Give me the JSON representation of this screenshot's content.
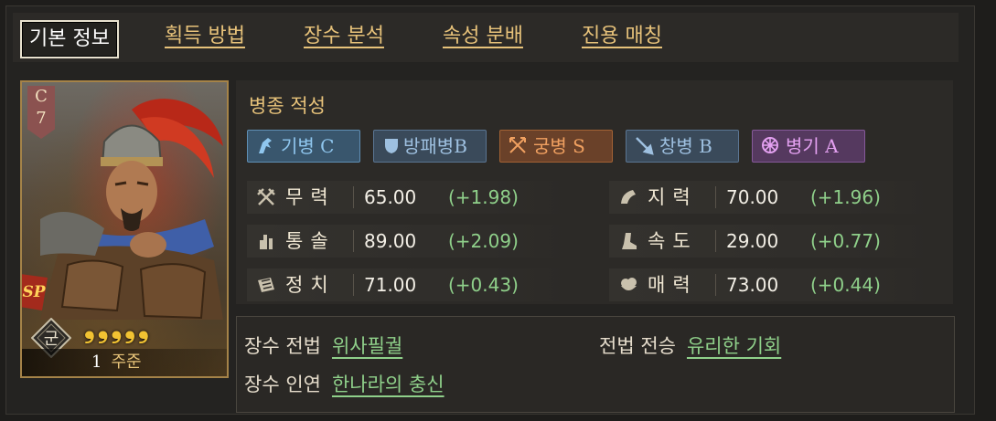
{
  "tabs": [
    "기본 정보",
    "획득 방법",
    "장수 분석",
    "속성 분배",
    "진용 매칭"
  ],
  "card": {
    "grade_letter": "C",
    "grade_number": "7",
    "sp_badge": "SP",
    "stars": "❟❟❟❟❟",
    "faction": "군",
    "level": "1",
    "name": "주준"
  },
  "troop_section": {
    "title": "병종 적성",
    "items": [
      {
        "label": "기병  C",
        "color": "#8fc6ee",
        "bg": "#39566d",
        "border": "#5f8fb5",
        "icon": "cavalry-icon"
      },
      {
        "label": "방패병B",
        "color": "#9ec0e0",
        "bg": "#3a4a5a",
        "border": "#5a7592",
        "icon": "shield-icon"
      },
      {
        "label": "궁병  S",
        "color": "#f0a060",
        "bg": "#6a4129",
        "border": "#a36234",
        "icon": "bow-icon"
      },
      {
        "label": "창병  B",
        "color": "#9ec0e0",
        "bg": "#3a4a5a",
        "border": "#5a7592",
        "icon": "spear-icon"
      },
      {
        "label": "병기  A",
        "color": "#e3a0f0",
        "bg": "#55395f",
        "border": "#86599a",
        "icon": "siege-icon"
      }
    ]
  },
  "stats": [
    {
      "label": "무력",
      "value": "65.00",
      "bonus": "(+1.98)",
      "icon": "sword-icon"
    },
    {
      "label": "지력",
      "value": "70.00",
      "bonus": "(+1.96)",
      "icon": "intellect-icon"
    },
    {
      "label": "통솔",
      "value": "89.00",
      "bonus": "(+2.09)",
      "icon": "command-icon"
    },
    {
      "label": "속도",
      "value": "29.00",
      "bonus": "(+0.77)",
      "icon": "boot-icon"
    },
    {
      "label": "정치",
      "value": "71.00",
      "bonus": "(+0.43)",
      "icon": "scroll-icon"
    },
    {
      "label": "매력",
      "value": "73.00",
      "bonus": "(+0.44)",
      "icon": "charm-icon"
    }
  ],
  "skills": {
    "tactic_label": "장수 전법",
    "tactic_value": "위사필궐",
    "inherit_label": "전법 전승",
    "inherit_value": "유리한 기회",
    "bond_label": "장수 인연",
    "bond_value": "한나라의 충신"
  }
}
